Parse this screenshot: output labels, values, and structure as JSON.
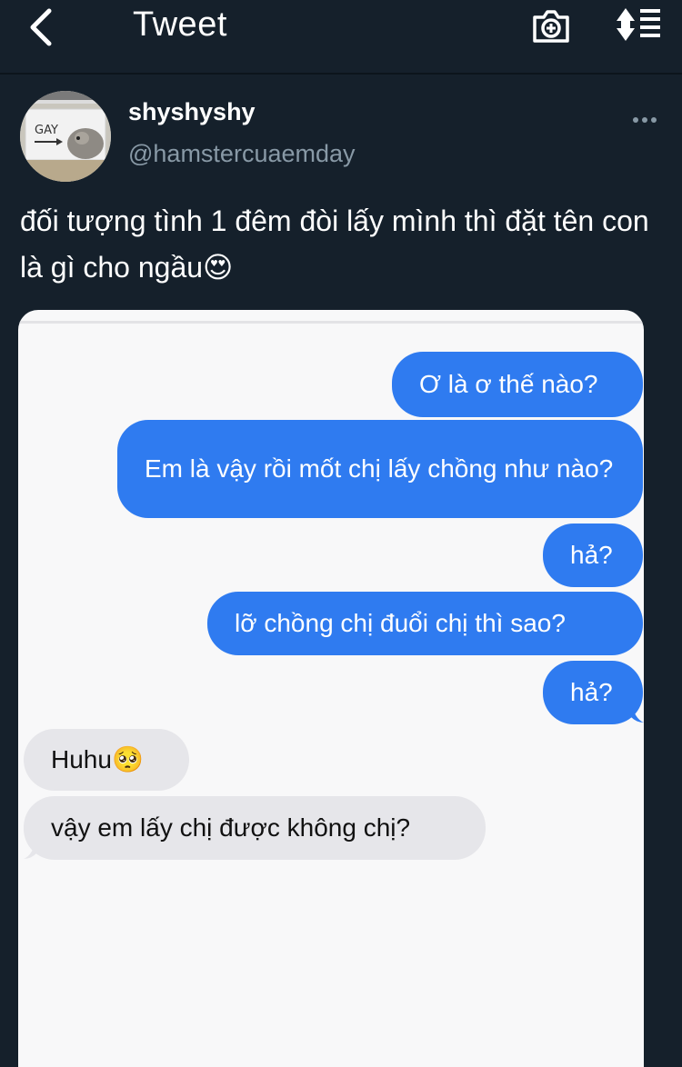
{
  "nav": {
    "title": "Tweet",
    "back_icon": "chevron-left-icon",
    "camera_icon": "camera-plus-icon",
    "sort_icon": "sort-list-icon"
  },
  "tweet": {
    "display_name": "shyshyshy",
    "handle": "@hamstercuaemday",
    "avatar_sign_text": "GAY",
    "text": "đối tượng tình 1 đêm đòi lấy mình thì đặt tên con là gì cho ngầu😍"
  },
  "chat": {
    "messages": [
      {
        "side": "out",
        "text": "Ơ là ơ thế nào?"
      },
      {
        "side": "out",
        "text": "Em là vậy rồi mốt chị lấy chồng như nào?"
      },
      {
        "side": "out",
        "text": "hả?"
      },
      {
        "side": "out",
        "text": "lỡ chồng chị đuổi chị thì sao?"
      },
      {
        "side": "out",
        "text": "hả?"
      },
      {
        "side": "in",
        "text": "Huhu🥺"
      },
      {
        "side": "in",
        "text": "vậy em lấy chị được không chị?"
      }
    ]
  },
  "colors": {
    "background": "#15202b",
    "out_bubble": "#2f7bf0",
    "in_bubble": "#e6e6ea",
    "handle": "#8899a6"
  }
}
